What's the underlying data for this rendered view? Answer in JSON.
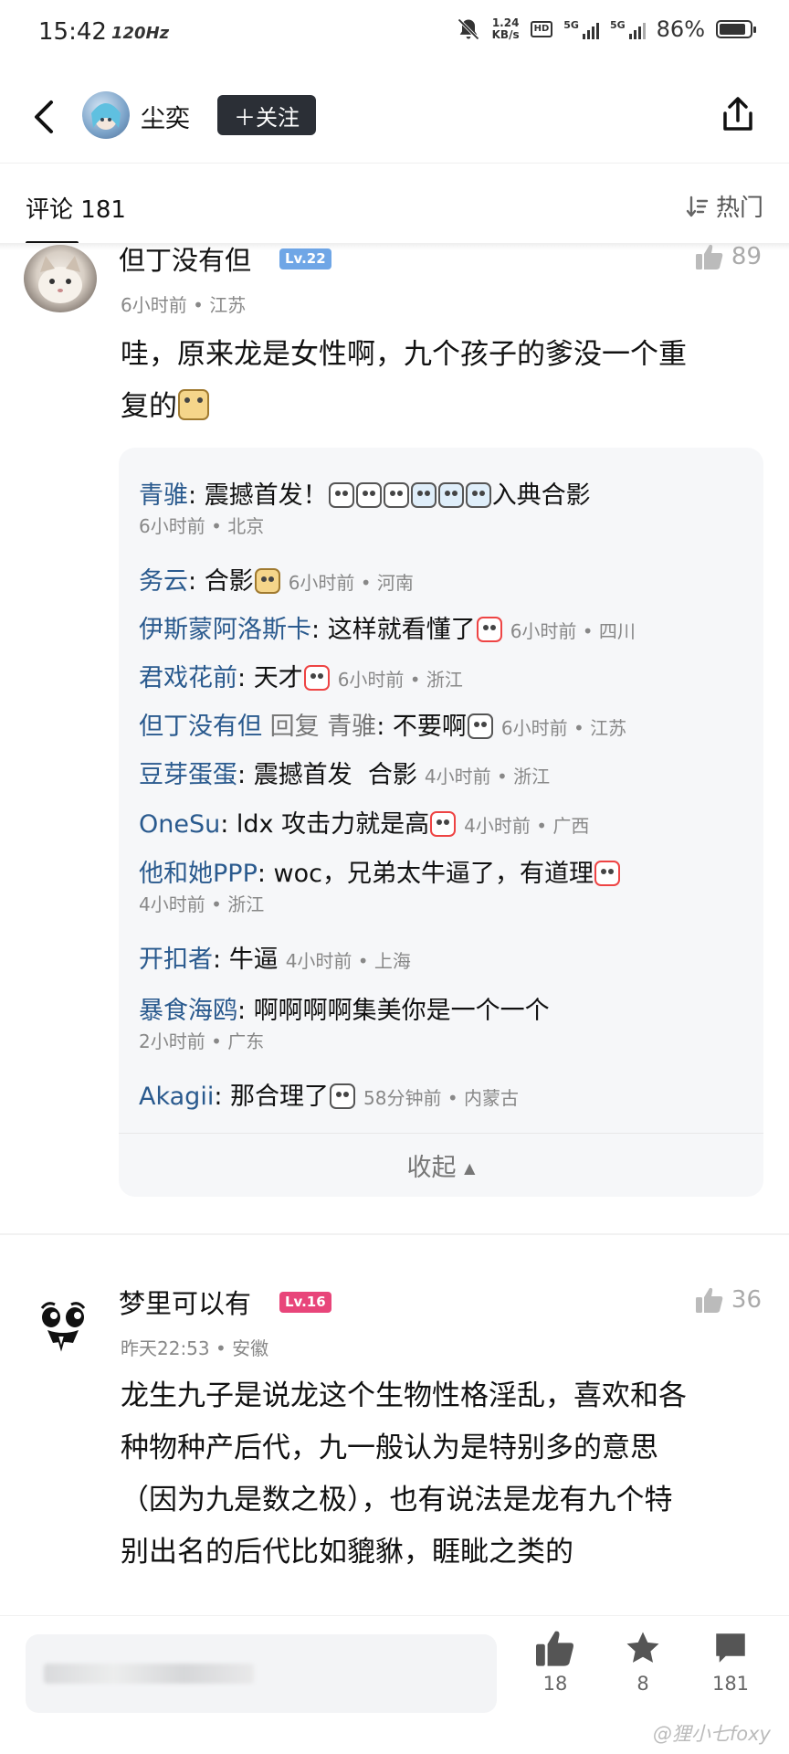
{
  "status_bar": {
    "time": "15:42",
    "refresh": "120Hz",
    "net_speed": "1.24",
    "net_unit": "KB/s",
    "hd1": "HD",
    "hd2": "HD",
    "sig1": "5G",
    "sig2": "5G",
    "battery": "86%",
    "battery_level": 0.86
  },
  "header": {
    "author": "尘奕",
    "follow_label": "＋关注"
  },
  "comments_bar": {
    "label": "评论",
    "count": "181",
    "sort_label": "热门"
  },
  "comment1": {
    "user": "但丁没有但",
    "level": "Lv.22",
    "likes": "89",
    "meta": "6小时前 • 江苏",
    "text_line1": "哇，原来龙是女性啊，九个孩子的爹没一个重",
    "text_line2": "复的",
    "replies": [
      {
        "user": "青骓",
        "text_a": "震撼首发！",
        "text_b": "入典合影",
        "meta": "6小时前 • 北京"
      },
      {
        "user": "务云",
        "text": "合影",
        "meta": "6小时前 • 河南"
      },
      {
        "user": "伊斯蒙阿洛斯卡",
        "text": "这样就看懂了",
        "meta": "6小时前 • 四川"
      },
      {
        "user": "君戏花前",
        "text": "天才",
        "meta": "6小时前 • 浙江"
      },
      {
        "user": "但丁没有但",
        "reply_word": "回复",
        "reply_to": "青骓",
        "text": "不要啊",
        "meta": "6小时前 • 江苏"
      },
      {
        "user": "豆芽蛋蛋",
        "text": "震撼首发  合影",
        "meta": "4小时前 • 浙江"
      },
      {
        "user": "OneSu",
        "text": "ldx 攻击力就是高",
        "meta": "4小时前 • 广西"
      },
      {
        "user": "他和她PPP",
        "text": "woc，兄弟太牛逼了，有道理",
        "meta": "4小时前 • 浙江"
      },
      {
        "user": "开扣者",
        "text": "牛逼",
        "meta": "4小时前 • 上海"
      },
      {
        "user": "暴食海鸥",
        "text": "啊啊啊啊集美你是一个一个",
        "meta": "2小时前 • 广东"
      },
      {
        "user": "Akagii",
        "text": "那合理了",
        "meta": "58分钟前 • 内蒙古"
      }
    ],
    "collapse_label": "收起"
  },
  "comment2": {
    "user": "梦里可以有",
    "level": "Lv.16",
    "likes": "36",
    "meta": "昨天22:53 • 安徽",
    "lines": [
      "龙生九子是说龙这个生物性格淫乱，喜欢和各",
      "种物种产后代，九一般认为是特别多的意思",
      "（因为九是数之极），也有说法是龙有九个特",
      "别出名的后代比如貔貅，睚眦之类的"
    ]
  },
  "bottom_bar": {
    "like_count": "18",
    "fav_count": "8",
    "comment_count": "181"
  },
  "watermark": "@狸小七foxy",
  "colors": {
    "accent_blue": "#2a5a8e",
    "lv22": "#6fa6e6",
    "lv16": "#e8457a",
    "follow_bg": "#2b2f36"
  }
}
